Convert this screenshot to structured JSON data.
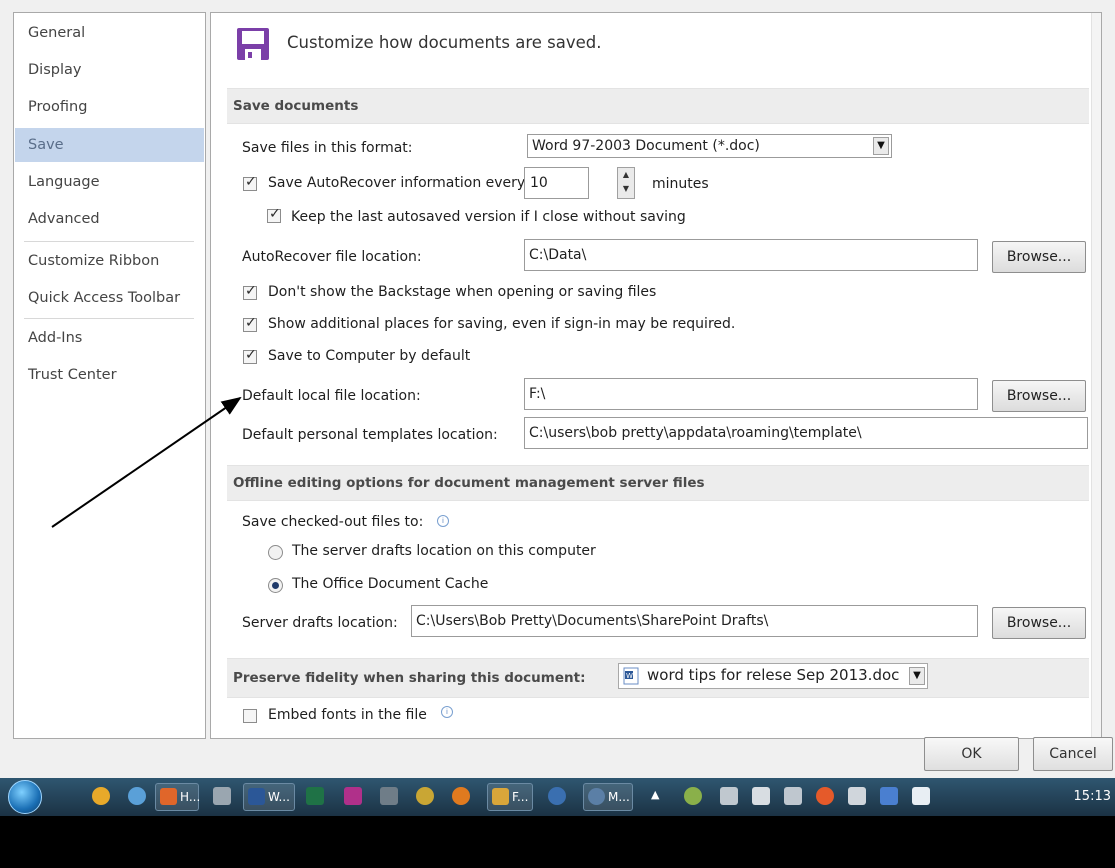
{
  "nav": {
    "items": [
      "General",
      "Display",
      "Proofing",
      "Save",
      "Language",
      "Advanced",
      "Customize Ribbon",
      "Quick Access Toolbar",
      "Add-Ins",
      "Trust Center"
    ],
    "selected": "Save"
  },
  "header": {
    "text": "Customize how documents are saved."
  },
  "save_documents": {
    "title": "Save documents",
    "format_label": "Save files in this format:",
    "format_value": "Word 97-2003 Document (*.doc)",
    "autorecover_label": "Save AutoRecover information every",
    "autorecover_value": "10",
    "minutes_label": "minutes",
    "keep_last_label": "Keep the last autosaved version if I close without saving",
    "autorecover_location_label": "AutoRecover file location:",
    "autorecover_location_value": "C:\\Data\\",
    "browse_label": "Browse...",
    "backstage_label": "Don't show the Backstage when opening or saving files",
    "additional_places_label": "Show additional places for saving, even if sign-in may be required.",
    "save_to_computer_label": "Save to Computer by default",
    "default_local_label": "Default local file location:",
    "default_local_value": "F:\\",
    "templates_label": "Default personal templates location:",
    "templates_value": "C:\\users\\bob pretty\\appdata\\roaming\\template\\"
  },
  "offline": {
    "title": "Offline editing options for document management server files",
    "checked_out_label": "Save checked-out files to:",
    "server_drafts_option": "The server drafts location on this computer",
    "office_cache_option": "The Office Document Cache",
    "server_drafts_label": "Server drafts location:",
    "server_drafts_value": "C:\\Users\\Bob Pretty\\Documents\\SharePoint Drafts\\"
  },
  "fidelity": {
    "title": "Preserve fidelity when sharing this document:",
    "document": "word tips for relese Sep 2013.doc",
    "embed_label": "Embed fonts in the file"
  },
  "dialog": {
    "ok": "OK",
    "cancel": "Cancel"
  },
  "taskbar": {
    "buttons": [
      "H...",
      "W...",
      "F...",
      "M..."
    ],
    "clock": "15:13"
  },
  "colors": {
    "accent_purple": "#7b3fa8",
    "nav_selected": "#c4d5ec"
  }
}
